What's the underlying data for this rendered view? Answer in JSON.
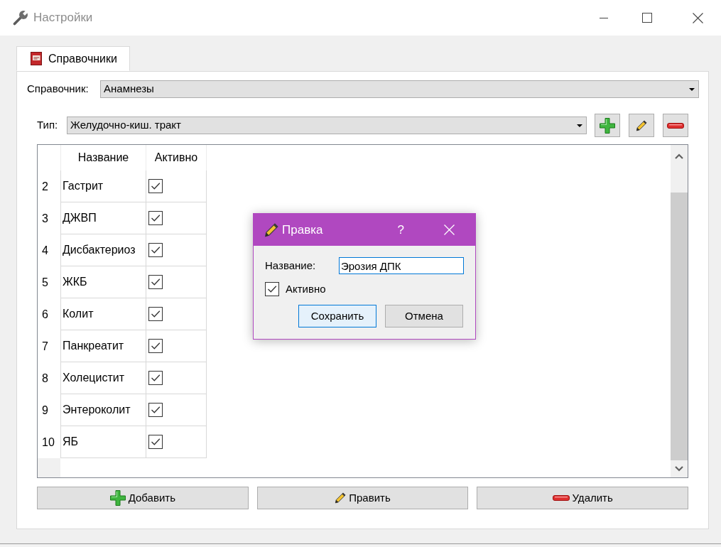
{
  "window": {
    "title": "Настройки"
  },
  "tabs": [
    {
      "label": "Справочники",
      "selected": true
    }
  ],
  "directory": {
    "label": "Справочник:",
    "value": "Анамнезы"
  },
  "type_filter": {
    "label": "Тип:",
    "value": "Желудочно-киш. тракт",
    "buttons": [
      {
        "kind": "add"
      },
      {
        "kind": "edit"
      },
      {
        "kind": "delete"
      }
    ]
  },
  "table": {
    "columns": [
      "Название",
      "Активно"
    ],
    "rows": [
      {
        "number": "2",
        "name": "Гастрит",
        "checked": true
      },
      {
        "number": "3",
        "name": "ДЖВП",
        "checked": true
      },
      {
        "number": "4",
        "name": "Дисбактериоз",
        "checked": true
      },
      {
        "number": "5",
        "name": "ЖКБ",
        "checked": true
      },
      {
        "number": "6",
        "name": "Колит",
        "checked": true
      },
      {
        "number": "7",
        "name": "Панкреатит",
        "checked": true
      },
      {
        "number": "8",
        "name": "Холецистит",
        "checked": true
      },
      {
        "number": "9",
        "name": "Энтероколит",
        "checked": true
      },
      {
        "number": "10",
        "name": "ЯБ",
        "checked": true
      }
    ]
  },
  "buttons": [
    {
      "kind": "add",
      "label": "Добавить"
    },
    {
      "kind": "edit",
      "label": "Править"
    },
    {
      "kind": "delete",
      "label": "Удалить"
    }
  ],
  "dialog": {
    "title": "Правка",
    "help": "?",
    "name_field": {
      "label": "Название:",
      "value": "Эрозия ДПК",
      "focused": true
    },
    "active_checkbox": {
      "label": "Активно",
      "checked": true
    },
    "buttons": [
      {
        "label": "Сохранить",
        "default": true
      },
      {
        "label": "Отмена",
        "default": false
      }
    ]
  }
}
